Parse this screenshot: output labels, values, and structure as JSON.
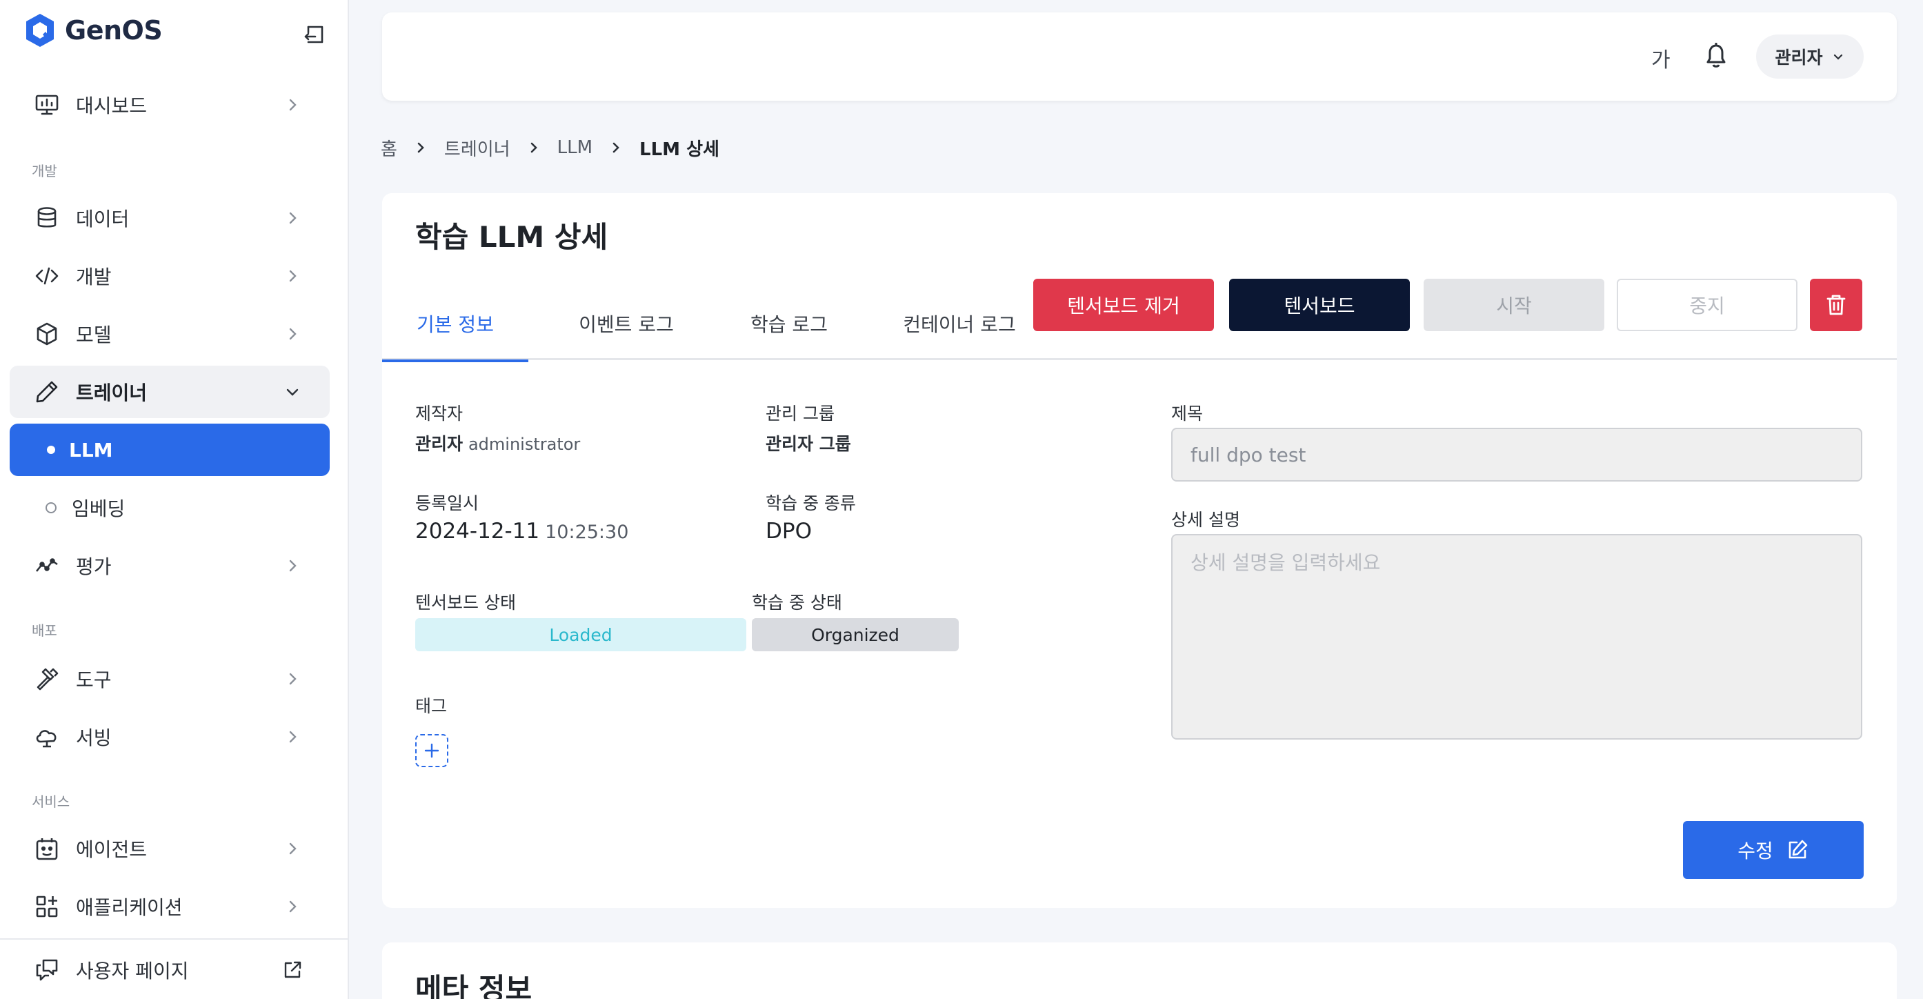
{
  "brand": {
    "name": "GenOS",
    "color": "#2a6ae8"
  },
  "sidebar": {
    "collapse_icon": "sidebar-collapse-icon",
    "items": [
      {
        "label": "대시보드",
        "icon": "monitor-icon"
      },
      {
        "section": "개발"
      },
      {
        "label": "데이터",
        "icon": "database-icon"
      },
      {
        "label": "개발",
        "icon": "code-icon"
      },
      {
        "label": "모델",
        "icon": "cube-icon"
      },
      {
        "label": "트레이너",
        "icon": "pencil-icon",
        "expanded": true
      },
      {
        "label": "LLM",
        "active": true
      },
      {
        "label": "임베딩"
      },
      {
        "label": "평가",
        "icon": "trend-icon"
      },
      {
        "section": "배포"
      },
      {
        "label": "도구",
        "icon": "hammer-icon"
      },
      {
        "label": "서빙",
        "icon": "cloud-icon"
      },
      {
        "section": "서비스"
      },
      {
        "label": "에이전트",
        "icon": "agent-icon"
      },
      {
        "label": "애플리케이션",
        "icon": "apps-icon"
      }
    ],
    "sections": {
      "dev": "개발",
      "deploy": "배포",
      "service": "서비스"
    },
    "labels": {
      "dashboard": "대시보드",
      "data": "데이터",
      "develop": "개발",
      "model": "모델",
      "trainer": "트레이너",
      "llm": "LLM",
      "embedding": "임베딩",
      "eval": "평가",
      "tools": "도구",
      "serving": "서빙",
      "agent": "에이전트",
      "apps": "애플리케이션"
    },
    "user_page": "사용자 페이지"
  },
  "header": {
    "font_size_label": "가",
    "user_label": "관리자"
  },
  "breadcrumb": {
    "home": "홈",
    "trainer": "트레이너",
    "llm": "LLM",
    "current": "LLM 상세"
  },
  "page": {
    "title": "학습 LLM 상세",
    "tabs": {
      "basic": "기본 정보",
      "event_log": "이벤트 로그",
      "train_log": "학습 로그",
      "container_log": "컨테이너 로그"
    },
    "actions": {
      "remove_tb": "텐서보드 제거",
      "tensorboard": "텐서보드",
      "start": "시작",
      "stop": "중지"
    },
    "fields": {
      "creator_label": "제작자",
      "creator_name": "관리자",
      "creator_id": "administrator",
      "group_label": "관리 그룹",
      "group_value": "관리자 그룹",
      "registered_label": "등록일시",
      "registered_date": "2024-12-11",
      "registered_time": "10:25:30",
      "train_type_label": "학습 중 종류",
      "train_type_value": "DPO",
      "tb_status_label": "텐서보드 상태",
      "tb_status_value": "Loaded",
      "train_status_label": "학습 중 상태",
      "train_status_value": "Organized",
      "tag_label": "태그",
      "title_label": "제목",
      "title_value": "full dpo test",
      "desc_label": "상세 설명",
      "desc_placeholder": "상세 설명을 입력하세요"
    },
    "edit_button": "수정"
  },
  "meta_section": {
    "title": "메타 정보"
  },
  "colors": {
    "accent": "#2a6ae8",
    "danger": "#e0384b",
    "dark": "#0b1733",
    "cyan_badge": "#2ab8cc"
  }
}
